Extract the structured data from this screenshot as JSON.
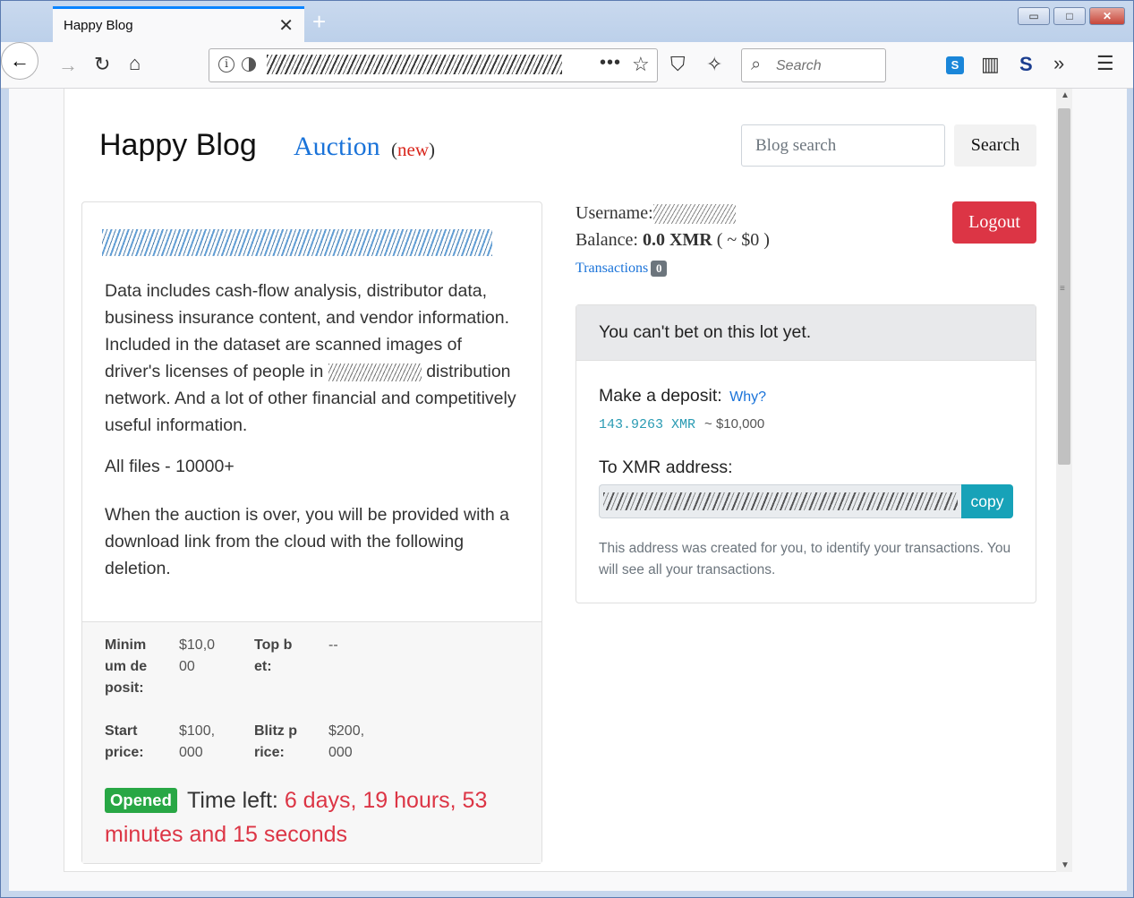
{
  "browser": {
    "tab_title": "Happy Blog",
    "tab_close": "✕",
    "new_tab": "+",
    "search_placeholder": "Search",
    "win_min": "▭",
    "win_max": "□",
    "win_close": "✕"
  },
  "header": {
    "brand": "Happy Blog",
    "auction_label": "Auction",
    "new_open": "(",
    "new_text": "new",
    "new_close": ")",
    "search_placeholder": "Blog search",
    "search_button": "Search"
  },
  "lot": {
    "description": "Data includes cash-flow analysis, distributor data, business insurance content, and vendor information. Included in the dataset are scanned images of driver's licenses of people in",
    "description_tail": "distribution network. And a lot of other financial and competitively useful information.",
    "files": "All files - 10000+",
    "note": "When the auction is over, you will be provided with a download link from the cloud with the following deletion.",
    "stats": {
      "min_deposit_label": "Minimum deposit:",
      "min_deposit_value": "$10,000",
      "top_bet_label": "Top bet:",
      "top_bet_value": "--",
      "start_price_label": "Start price:",
      "start_price_value": "$100,000",
      "blitz_price_label": "Blitz price:",
      "blitz_price_value": "$200,000"
    },
    "status_badge": "Opened",
    "time_left_label": "Time left:",
    "time_left_value": "6 days, 19 hours, 53 minutes and 15 seconds"
  },
  "account": {
    "username_label": "Username:",
    "balance_label": "Balance:",
    "balance_value": "0.0 XMR",
    "balance_usd": "( ~ $0 )",
    "transactions_label": "Transactions",
    "transactions_count": "0",
    "logout_button": "Logout"
  },
  "bet": {
    "header": "You can't bet on this lot yet.",
    "deposit_label": "Make a deposit:",
    "why_link": "Why?",
    "xmr_amount": "143.9263 XMR",
    "usd_amount": "~ $10,000",
    "to_address_label": "To XMR address:",
    "copy_button": "copy",
    "help_text": "This address was created for you, to identify your transactions. You will see all your transactions."
  },
  "colors": {
    "accent_link": "#1a73d9",
    "danger": "#dc3545",
    "success": "#28a745",
    "info": "#17a2b8"
  }
}
